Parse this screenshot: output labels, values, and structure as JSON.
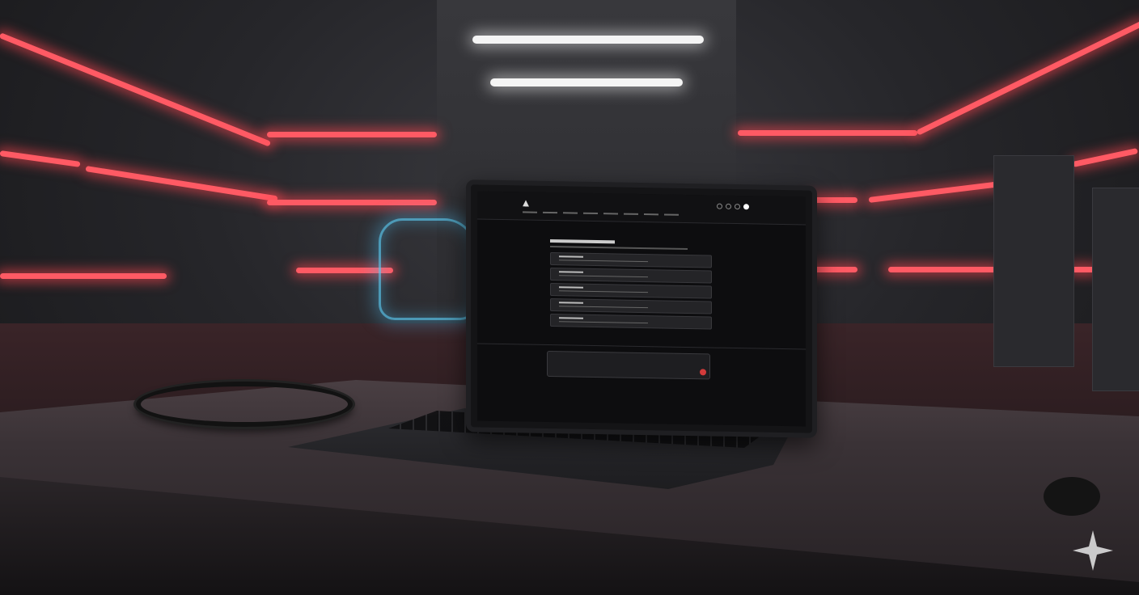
{
  "scene": {
    "description_colors": {
      "neon": "#ff4b55",
      "hologram": "#5ac8f0",
      "wall": "#2c2c30",
      "screen_bg": "#0d0d0f",
      "send_button": "#d23b3b"
    },
    "icons": [
      "logo-icon",
      "notification-icon",
      "settings-icon",
      "avatar-icon",
      "send-icon",
      "sparkle-icon"
    ]
  }
}
